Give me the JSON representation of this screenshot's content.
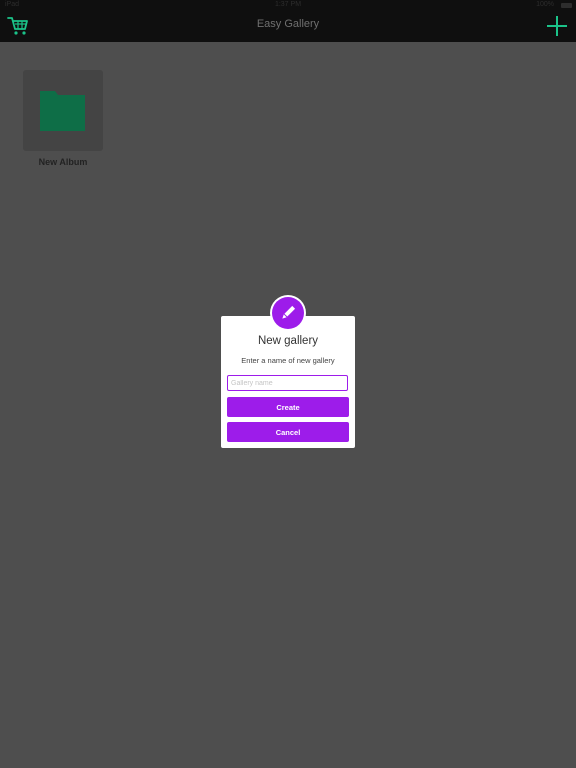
{
  "status_bar": {
    "carrier": "iPad",
    "time": "1:37 PM",
    "battery": "100%"
  },
  "nav": {
    "title": "Easy Gallery",
    "left_icon": "cart-icon",
    "right_icon": "plus-icon"
  },
  "albums": [
    {
      "name": "New Album",
      "icon": "folder-icon"
    }
  ],
  "dialog": {
    "icon": "pencil-icon",
    "title": "New gallery",
    "message": "Enter a name of new gallery",
    "input": {
      "value": "",
      "placeholder": "Gallery name"
    },
    "create_label": "Create",
    "cancel_label": "Cancel"
  },
  "colors": {
    "accent": "#9d1cea",
    "green_icon": "#1bc389",
    "folder": "#0e6e47",
    "overlay_bg": "#4e4e4e",
    "bar_bg": "#0f0f0f"
  }
}
